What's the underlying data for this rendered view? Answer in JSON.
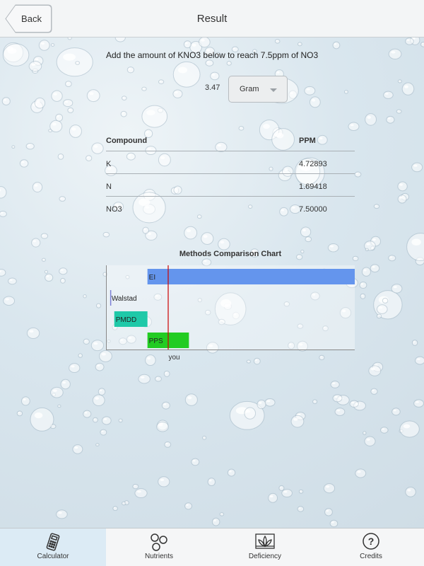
{
  "header": {
    "back_label": "Back",
    "title": "Result"
  },
  "result": {
    "instruction": "Add the amount of KNO3 below to reach 7.5ppm of NO3",
    "amount": "3.47",
    "unit_selected": "Gram"
  },
  "table": {
    "columns": [
      "Compound",
      "PPM"
    ],
    "rows": [
      {
        "compound": "K",
        "ppm": "4.72893"
      },
      {
        "compound": "N",
        "ppm": "1.69418"
      },
      {
        "compound": "NO3",
        "ppm": "7.50000"
      }
    ]
  },
  "chart_data": {
    "type": "bar",
    "title": "Methods Comparison Chart",
    "orientation": "horizontal",
    "categories": [
      "EI",
      "Walstad",
      "PMDD",
      "PPS"
    ],
    "ranges": [
      {
        "name": "EI",
        "start": 5,
        "end": 30,
        "color": "#6495ed"
      },
      {
        "name": "Walstad",
        "start": 0.5,
        "end": 0.6,
        "color": "#7b7fd6"
      },
      {
        "name": "PMDD",
        "start": 1,
        "end": 5,
        "color": "#1fc9a8"
      },
      {
        "name": "PPS",
        "start": 5,
        "end": 10,
        "color": "#22cc22"
      }
    ],
    "xlim": [
      0,
      30
    ],
    "marker": {
      "label": "you",
      "value": 7.5,
      "color": "#cc0000"
    },
    "grid": false
  },
  "tabs": [
    {
      "label": "Calculator",
      "icon": "calculator-icon",
      "active": true
    },
    {
      "label": "Nutrients",
      "icon": "nutrients-icon",
      "active": false
    },
    {
      "label": "Deficiency",
      "icon": "deficiency-icon",
      "active": false
    },
    {
      "label": "Credits",
      "icon": "help-icon",
      "active": false
    }
  ]
}
